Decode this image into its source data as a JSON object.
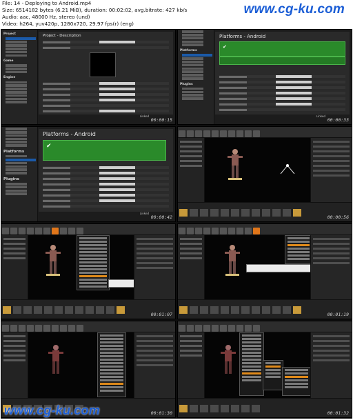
{
  "header": {
    "file_line": "File: 14 - Deploying to Android.mp4",
    "size_line": "Size: 6514182 bytes (6.21 MiB), duration: 00:02:02, avg.bitrate: 427 kb/s",
    "audio_line": "Audio: aac, 48000 Hz, stereo (und)",
    "video_line": "Video: h264, yuv420p, 1280x720, 29.97 fps(r) (eng)"
  },
  "watermark": "www.cg-ku.com",
  "brand": "Linked",
  "tiles": [
    {
      "title": "Project - Description",
      "timestamp": "00:00:15",
      "sidebar_heads": [
        "Project",
        "Game",
        "Engine"
      ]
    },
    {
      "title": "Platforms - Android",
      "timestamp": "00:00:33",
      "sidebar_heads": [
        "Platforms",
        "Plugins"
      ]
    },
    {
      "title": "Platforms - Android",
      "timestamp": "00:00:42",
      "sidebar_heads": [
        "Platforms",
        "Plugins"
      ]
    },
    {
      "title": "",
      "timestamp": "00:00:56",
      "sidebar_heads": []
    },
    {
      "title": "",
      "timestamp": "00:01:07",
      "sidebar_heads": []
    },
    {
      "title": "",
      "timestamp": "00:01:19",
      "sidebar_heads": []
    },
    {
      "title": "",
      "timestamp": "00:01:30",
      "sidebar_heads": []
    },
    {
      "title": "",
      "timestamp": "00:01:32",
      "sidebar_heads": []
    }
  ]
}
